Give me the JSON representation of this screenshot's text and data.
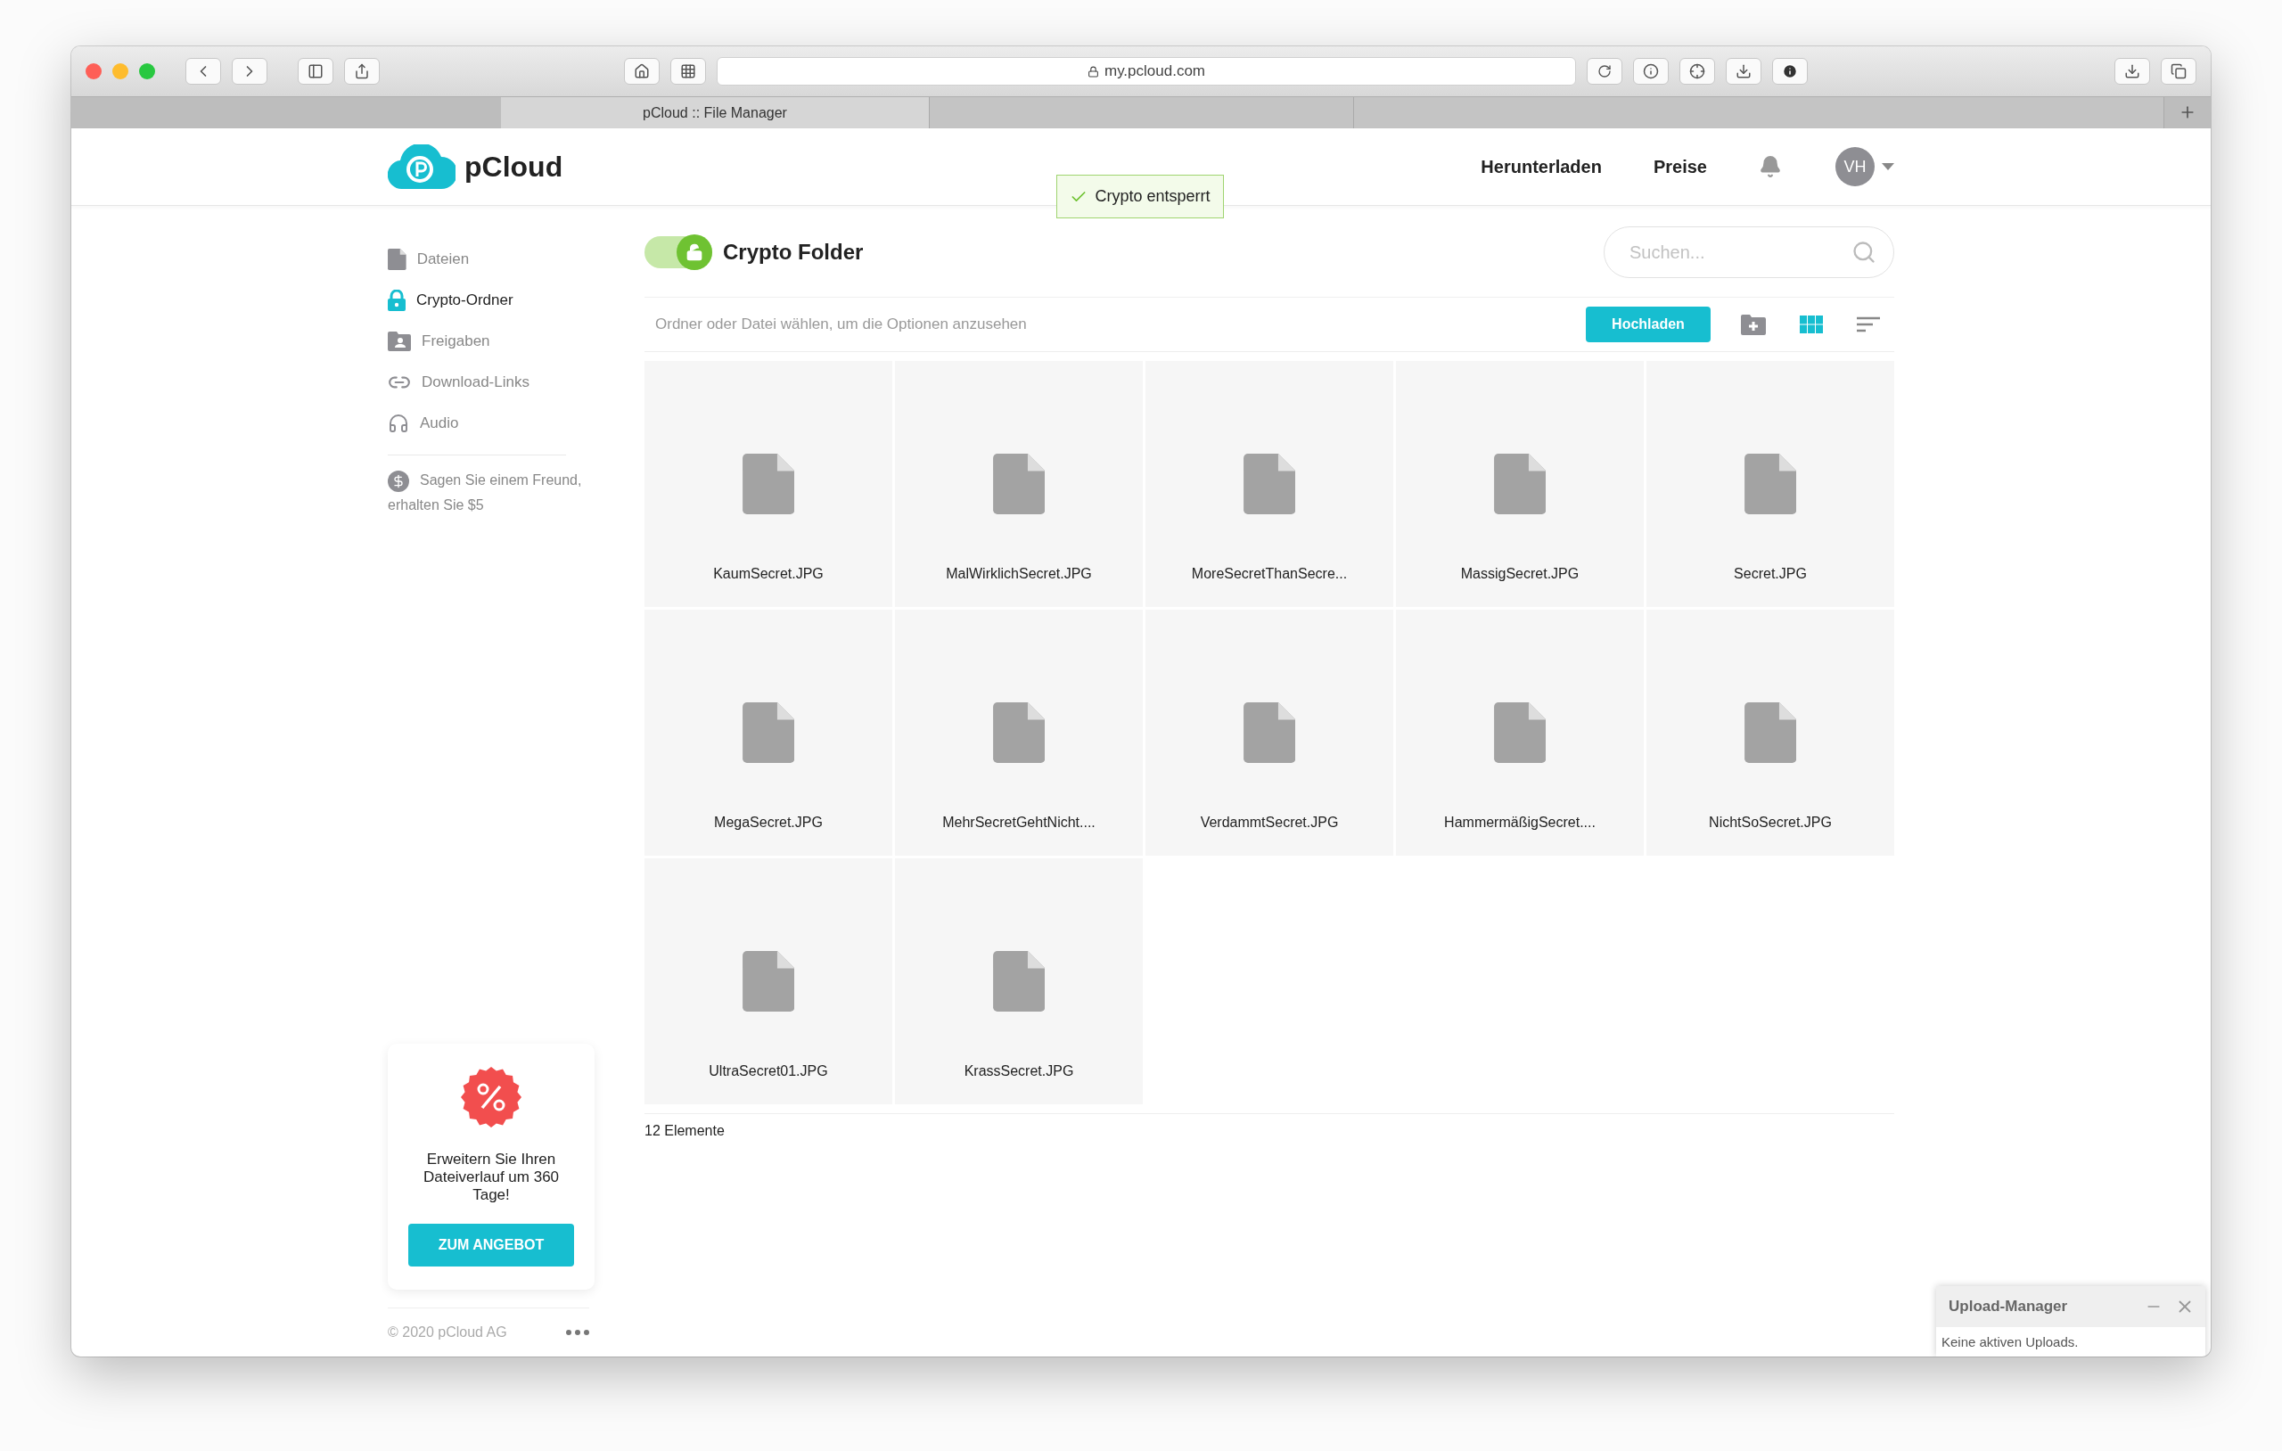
{
  "browser": {
    "url": "my.pcloud.com",
    "tabs": [
      {
        "title": "pCloud :: File Manager",
        "selected": true
      },
      {
        "selected": false
      },
      {
        "selected": false
      }
    ]
  },
  "header": {
    "logo": "pCloud",
    "nav": [
      "Herunterladen",
      "Preise"
    ],
    "avatar": "VH"
  },
  "toast": {
    "text": "Crypto entsperrt"
  },
  "sidebar": {
    "items": [
      {
        "kind": "file",
        "label": "Dateien",
        "selected": false
      },
      {
        "kind": "lock",
        "label": "Crypto-Ordner",
        "selected": true
      },
      {
        "kind": "shared",
        "label": "Freigaben",
        "selected": false
      },
      {
        "kind": "link",
        "label": "Download-Links",
        "selected": false
      },
      {
        "kind": "audio",
        "label": "Audio",
        "selected": false
      }
    ],
    "referral": "Sagen Sie einem Freund, erhalten Sie $5",
    "promo": {
      "text": "Erweitern Sie Ihren Dateiverlauf um 360 Tage!",
      "button": "ZUM ANGEBOT"
    },
    "copyright": "© 2020 pCloud AG"
  },
  "folder": {
    "title": "Crypto Folder",
    "unlocked": true,
    "search_placeholder": "Suchen...",
    "hint": "Ordner oder Datei wählen, um die Optionen anzusehen",
    "upload_button": "Hochladen",
    "files": [
      {
        "name": "KaumSecret.JPG"
      },
      {
        "name": "MalWirklichSecret.JPG"
      },
      {
        "name": "MoreSecretThanSecre..."
      },
      {
        "name": "MassigSecret.JPG"
      },
      {
        "name": "Secret.JPG"
      },
      {
        "name": "MegaSecret.JPG"
      },
      {
        "name": "MehrSecretGehtNicht...."
      },
      {
        "name": "VerdammtSecret.JPG"
      },
      {
        "name": "HammermäßigSecret...."
      },
      {
        "name": "NichtSoSecret.JPG"
      },
      {
        "name": "UltraSecret01.JPG"
      },
      {
        "name": "KrassSecret.JPG"
      }
    ],
    "count": "12 Elemente"
  },
  "upload_manager": {
    "title": "Upload-Manager",
    "status": "Keine aktiven Uploads."
  }
}
